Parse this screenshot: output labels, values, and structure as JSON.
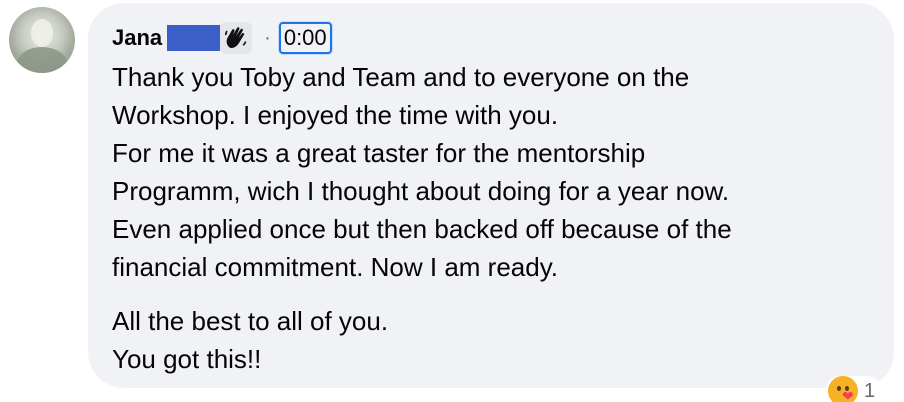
{
  "comment": {
    "author_name": "Jana",
    "separator": "·",
    "timestamp_link": "0:00",
    "paragraph_1": [
      "Thank you Toby and Team and to everyone on the",
      "Workshop. I enjoyed the time with you.",
      "For me it was a great taster for the mentorship",
      "Programm, wich I thought about doing for a year now.",
      "Even applied once but then backed off because of the",
      "financial commitment. Now I am ready."
    ],
    "paragraph_2": [
      "All the best to all of you.",
      "You got this!!"
    ],
    "reaction_count": "1",
    "redaction_color": "#3a5fc7",
    "bubble_color": "#f0f2f5",
    "focus_color": "#1e73e8"
  },
  "icons": {
    "badge": "waving-hand-icon",
    "reaction": "care-reaction-icon"
  }
}
